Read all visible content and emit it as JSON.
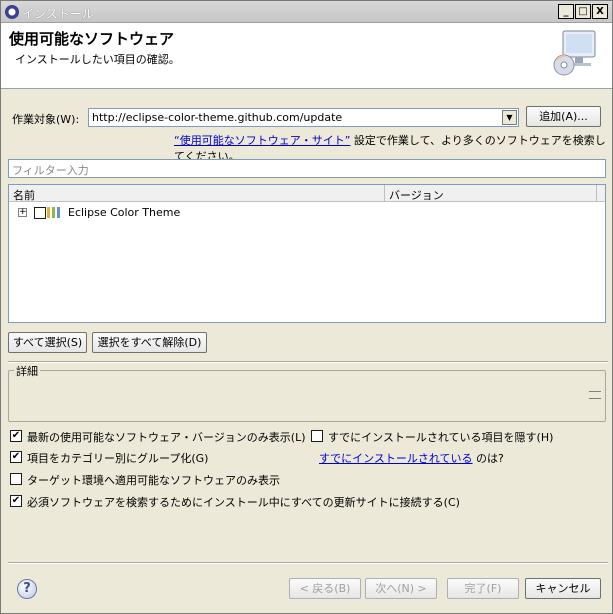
{
  "window": {
    "title": "インストール",
    "controls": {
      "minimize": "_",
      "maximize": "□",
      "close": "X"
    }
  },
  "banner": {
    "heading": "使用可能なソフトウェア",
    "subtitle": "インストールしたい項目の確認。"
  },
  "work_with": {
    "label": "作業対象(W):",
    "value": "http://eclipse-color-theme.github.com/update",
    "add_label": "追加(A)...",
    "link_text": "“使用可能なソフトウェア・サイト”",
    "hint_suffix": " 設定で作業して、より多くのソフトウェアを検索してください。"
  },
  "filter": {
    "placeholder": "フィルター入力"
  },
  "table": {
    "columns": [
      "名前",
      "バージョン"
    ],
    "rows": [
      {
        "name": "Eclipse Color Theme",
        "version": ""
      }
    ]
  },
  "selection_buttons": {
    "select_all": "すべて選択(S)",
    "deselect_all": "選択をすべて解除(D)"
  },
  "details": {
    "title": "詳細"
  },
  "options": {
    "latest_only": {
      "label": "最新の使用可能なソフトウェア・バージョンのみ表示(L)",
      "checked": true
    },
    "hide_installed": {
      "label": "すでにインストールされている項目を隠す(H)",
      "checked": false
    },
    "group_by_category": {
      "label": "項目をカテゴリー別にグループ化(G)",
      "checked": true
    },
    "already_installed_link": "すでにインストールされている",
    "already_installed_suffix": " のは?",
    "target_only": {
      "label": "ターゲット環境へ適用可能なソフトウェアのみ表示",
      "checked": false
    },
    "contact_all_sites": {
      "label": "必須ソフトウェアを検索するためにインストール中にすべての更新サイトに接続する(C)",
      "checked": true
    }
  },
  "footer": {
    "help_symbol": "?",
    "back": "< 戻る(B)",
    "next": "次へ(N) >",
    "finish": "完了(F)",
    "cancel": "キャンセル"
  },
  "colors": {
    "dialog_bg": "#ece9d8",
    "link": "#0000cc",
    "field_border": "#7f9db9"
  }
}
